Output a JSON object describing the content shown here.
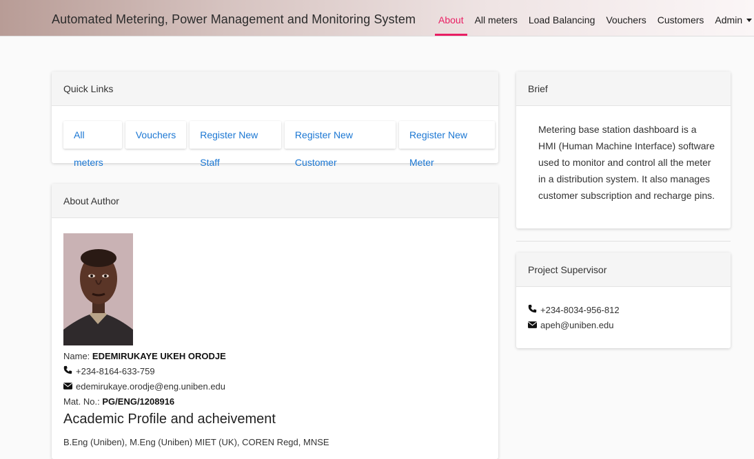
{
  "navbar": {
    "brand": "Automated Metering, Power Management and Monitoring System",
    "items": [
      {
        "label": "About",
        "active": true
      },
      {
        "label": "All meters"
      },
      {
        "label": "Load Balancing"
      },
      {
        "label": "Vouchers"
      },
      {
        "label": "Customers"
      },
      {
        "label": "Admin"
      }
    ],
    "accent": "#e91e63"
  },
  "quick_links": {
    "title": "Quick Links",
    "buttons": [
      "All meters",
      "Vouchers",
      "Register New Staff",
      "Register New Customer",
      "Register New Meter"
    ],
    "link_color": "#1b77d3"
  },
  "about_author": {
    "title": "About Author",
    "name_label": "Name:",
    "name": "EDEMIRUKAYE UKEH ORODJE",
    "phone": "+234-8164-633-759",
    "email": "edemirukaye.orodje@eng.uniben.edu",
    "mat_label": "Mat. No.:",
    "mat_no": "PG/ENG/1208916",
    "profile_heading": "Academic Profile and acheivement",
    "qualifications": "B.Eng (Uniben), M.Eng (Uniben) MIET (UK), COREN Regd, MNSE"
  },
  "brief": {
    "title": "Brief",
    "text": "Metering base station dashboard is a HMI (Human Machine Interface) software used to monitor and control all the meter in a distribution system. It also manages customer subscription and recharge pins."
  },
  "supervisor": {
    "title": "Project Supervisor",
    "phone": "+234-8034-956-812",
    "email": "apeh@uniben.edu"
  },
  "icons": {
    "phone": "phone-icon",
    "email": "envelope-icon",
    "dropdown": "caret-down-icon"
  }
}
